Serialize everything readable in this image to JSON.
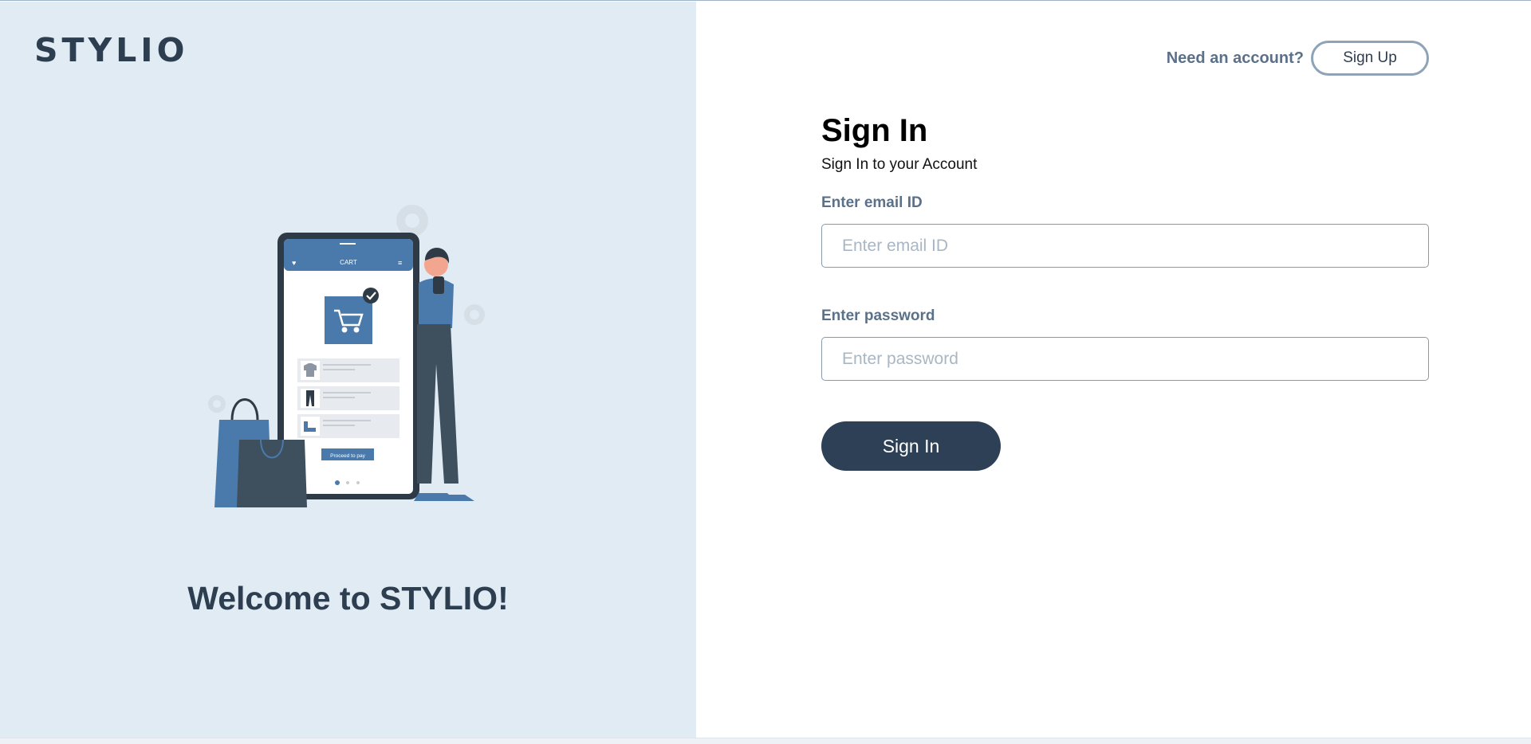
{
  "brand": {
    "logo": "STYLIO"
  },
  "hero": {
    "welcome": "Welcome to STYLIO!",
    "illustration": {
      "cart_title": "CART",
      "proceed_label": "Proceed to pay"
    }
  },
  "header": {
    "prompt": "Need an account?",
    "signup_label": "Sign Up"
  },
  "form": {
    "title": "Sign In",
    "subtitle": "Sign In to your Account",
    "email": {
      "label": "Enter email ID",
      "placeholder": "Enter email ID",
      "value": ""
    },
    "password": {
      "label": "Enter password",
      "placeholder": "Enter password",
      "value": ""
    },
    "submit_label": "Sign In"
  },
  "colors": {
    "panel": "#e1ebf4",
    "primary": "#2e4055",
    "accent": "#4a7aab",
    "label": "#5b7089"
  }
}
